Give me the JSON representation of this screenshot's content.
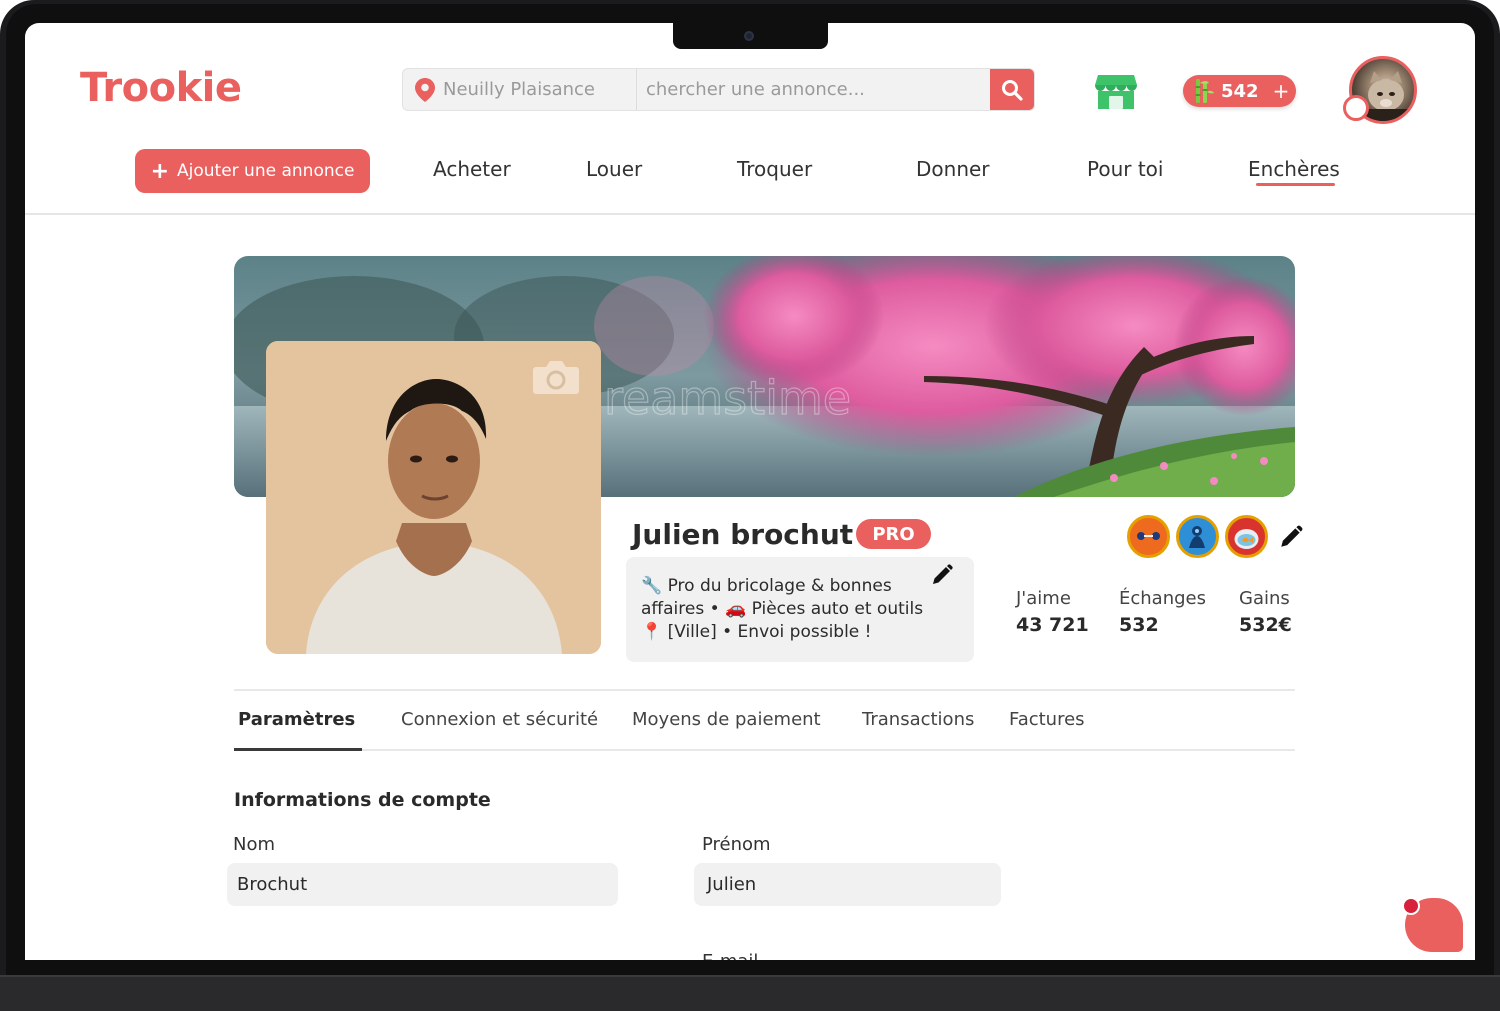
{
  "app": {
    "logo": "Trookie"
  },
  "search": {
    "location": "Neuilly Plaisance",
    "placeholder": "chercher une annonce..."
  },
  "header": {
    "coins": "542",
    "coins_plus": "+"
  },
  "nav": {
    "add_label": "Ajouter une annonce",
    "add_plus": "+",
    "items": [
      "Acheter",
      "Louer",
      "Troquer",
      "Donner",
      "Pour toi",
      "Enchères"
    ],
    "active": "Enchères"
  },
  "profile": {
    "name": "Julien brochut",
    "badge": "PRO",
    "bio_lines": [
      "🔧 Pro du bricolage & bonnes",
      "affaires • 🚗 Pièces auto et outils",
      "📍 [Ville] • Envoi possible !"
    ],
    "stats": [
      {
        "label": "J'aime",
        "value": "43 721"
      },
      {
        "label": "Échanges",
        "value": "532"
      },
      {
        "label": "Gains",
        "value": "532€"
      }
    ],
    "banner_watermark": "reamstime"
  },
  "tabs": [
    "Paramètres",
    "Connexion et sécurité",
    "Moyens de paiement",
    "Transactions",
    "Factures"
  ],
  "account": {
    "title": "Informations de compte",
    "nom_label": "Nom",
    "nom_value": "Brochut",
    "prenom_label": "Prénom",
    "prenom_value": "Julien",
    "email_label": "E-mail"
  },
  "colors": {
    "accent": "#e9605f",
    "badge_ring": "#e5a000"
  },
  "icons": [
    "location-pin-icon",
    "search-icon",
    "store-icon",
    "bamboo-icon",
    "camera-icon",
    "pencil-icon",
    "chat-icon"
  ]
}
